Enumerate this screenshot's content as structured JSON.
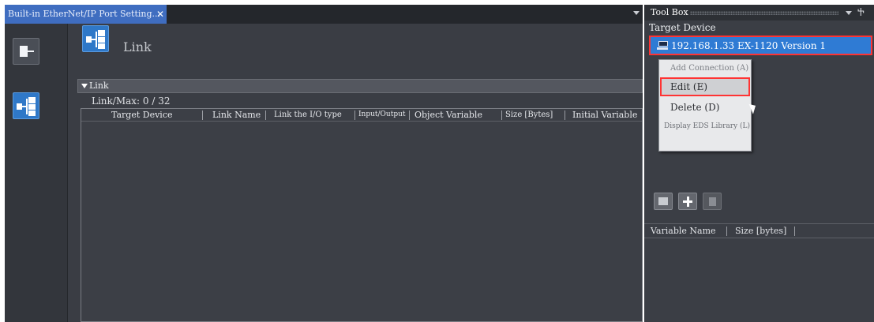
{
  "editor": {
    "tab_label": "Built-in EtherNet/IP Port Setting...",
    "tab_close": "✕",
    "header_title": "Link",
    "section_title": "Link",
    "link_max": "Link/Max: 0 / 32"
  },
  "table": {
    "columns": [
      "Target Device",
      "Link Name",
      "Link the I/O type",
      "Input/Output",
      "Object Variable",
      "Size [Bytes]",
      "Initial Variable"
    ]
  },
  "toolbox": {
    "title": "Tool Box",
    "pin": "Ⴕ",
    "target_device_label": "Target Device",
    "device": "192.168.1.33   EX-1120   Version 1",
    "context_menu": {
      "add_connection": "Add Connection (A)",
      "edit": "Edit (E)",
      "delete": "Delete (D)",
      "display_eds": "Display EDS Library (L)"
    },
    "variable_columns": [
      "Variable Name",
      "Size [bytes]"
    ]
  },
  "icons": {
    "side_single": "device-single-icon",
    "side_link": "link-icon",
    "header_link": "link-icon",
    "toolbar": [
      "folder-icon",
      "add-icon",
      "delete-icon"
    ]
  },
  "colors": {
    "accent_blue": "#2f7bd4",
    "highlight_red": "#ff3333",
    "panel_bg": "#3a3d44"
  }
}
